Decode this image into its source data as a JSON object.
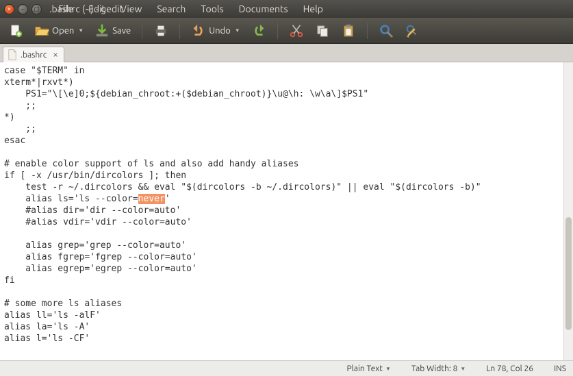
{
  "titlebar": {
    "title": ".bashrc (~) - gedit",
    "menus": [
      "File",
      "Edit",
      "View",
      "Search",
      "Tools",
      "Documents",
      "Help"
    ]
  },
  "toolbar": {
    "open_label": "Open",
    "save_label": "Save",
    "undo_label": "Undo"
  },
  "tabs": [
    {
      "label": ".bashrc"
    }
  ],
  "editor": {
    "pre_highlight": "case \"$TERM\" in\nxterm*|rxvt*)\n    PS1=\"\\[\\e]0;${debian_chroot:+($debian_chroot)}\\u@\\h: \\w\\a\\]$PS1\"\n    ;;\n*)\n    ;;\nesac\n\n# enable color support of ls and also add handy aliases\nif [ -x /usr/bin/dircolors ]; then\n    test -r ~/.dircolors && eval \"$(dircolors -b ~/.dircolors)\" || eval \"$(dircolors -b)\"\n    alias ls='ls --color=",
    "highlighted": "never",
    "post_highlight": "'\n    #alias dir='dir --color=auto'\n    #alias vdir='vdir --color=auto'\n\n    alias grep='grep --color=auto'\n    alias fgrep='fgrep --color=auto'\n    alias egrep='egrep --color=auto'\nfi\n\n# some more ls aliases\nalias ll='ls -alF'\nalias la='ls -A'\nalias l='ls -CF'"
  },
  "statusbar": {
    "syntax": "Plain Text",
    "tabwidth": "Tab Width: 8",
    "position": "Ln 78, Col 26",
    "insert_mode": "INS"
  }
}
